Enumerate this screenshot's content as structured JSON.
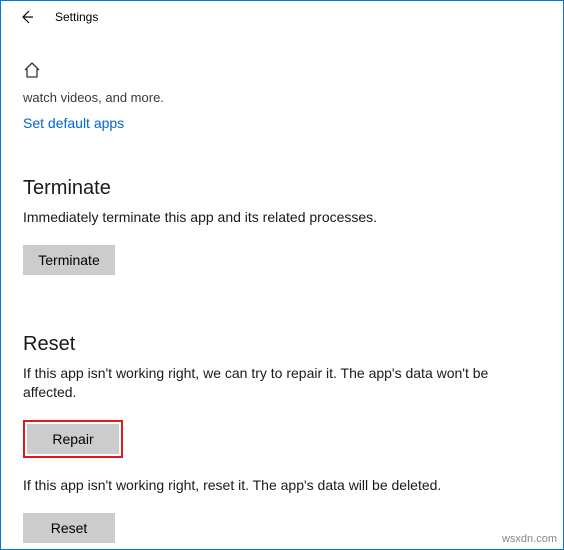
{
  "window": {
    "title": "Settings"
  },
  "cut_text": "watch videos, and more.",
  "link_set_default": "Set default apps",
  "terminate": {
    "heading": "Terminate",
    "desc": "Immediately terminate this app and its related processes.",
    "button": "Terminate"
  },
  "reset": {
    "heading": "Reset",
    "repair_desc": "If this app isn't working right, we can try to repair it. The app's data won't be affected.",
    "repair_button": "Repair",
    "reset_desc": "If this app isn't working right, reset it. The app's data will be deleted.",
    "reset_button": "Reset"
  },
  "watermark": "wsxdn.com"
}
